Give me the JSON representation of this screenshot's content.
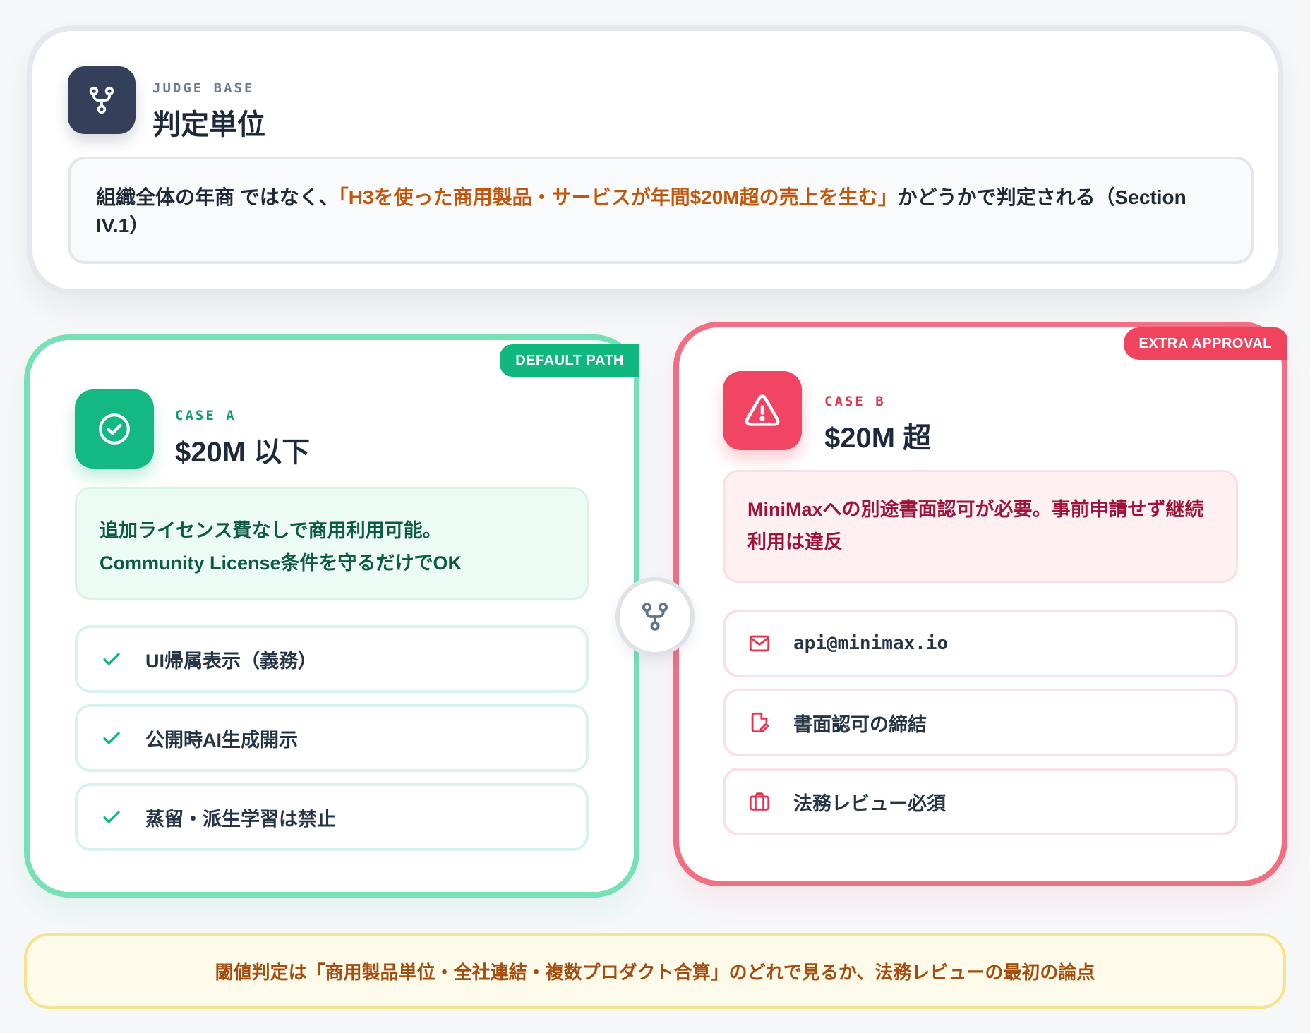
{
  "judge": {
    "eyebrow": "JUDGE BASE",
    "title": "判定単位",
    "icon": "branch-icon",
    "note_prefix": "組織全体の年商 ではなく、",
    "note_highlight": "「H3を使った商用製品・サービスが年間$20M超の売上を生む」",
    "note_suffix": "かどうかで判定される（Section IV.1）"
  },
  "case_a": {
    "tag": "DEFAULT PATH",
    "eyebrow": "CASE A",
    "title": "$20M 以下",
    "icon": "check-circle-icon",
    "summary_line1": "追加ライセンス費なしで商用利用可能。",
    "summary_line2": "Community License条件を守るだけでOK",
    "items": [
      {
        "label": "UI帰属表示（義務）",
        "icon": "check-icon"
      },
      {
        "label": "公開時AI生成開示",
        "icon": "check-icon"
      },
      {
        "label": "蒸留・派生学習は禁止",
        "icon": "check-icon"
      }
    ]
  },
  "case_b": {
    "tag": "EXTRA APPROVAL",
    "eyebrow": "CASE B",
    "title": "$20M 超",
    "icon": "warning-triangle-icon",
    "summary": "MiniMaxへの別途書面認可が必要。事前申請せず継続利用は違反",
    "items": [
      {
        "label": "api@minimax.io",
        "icon": "mail-icon"
      },
      {
        "label": "書面認可の締結",
        "icon": "document-sign-icon"
      },
      {
        "label": "法務レビュー必須",
        "icon": "briefcase-icon"
      }
    ]
  },
  "connector": {
    "icon": "branch-icon"
  },
  "footer": {
    "text": "閾値判定は「商用製品単位・全社連結・複数プロダクト合算」のどれで見るか、法務レビューの最初の論点"
  },
  "colors": {
    "green": "#10b77f",
    "red": "#f0435d",
    "navy": "#34405a",
    "orange": "#c2570b"
  }
}
